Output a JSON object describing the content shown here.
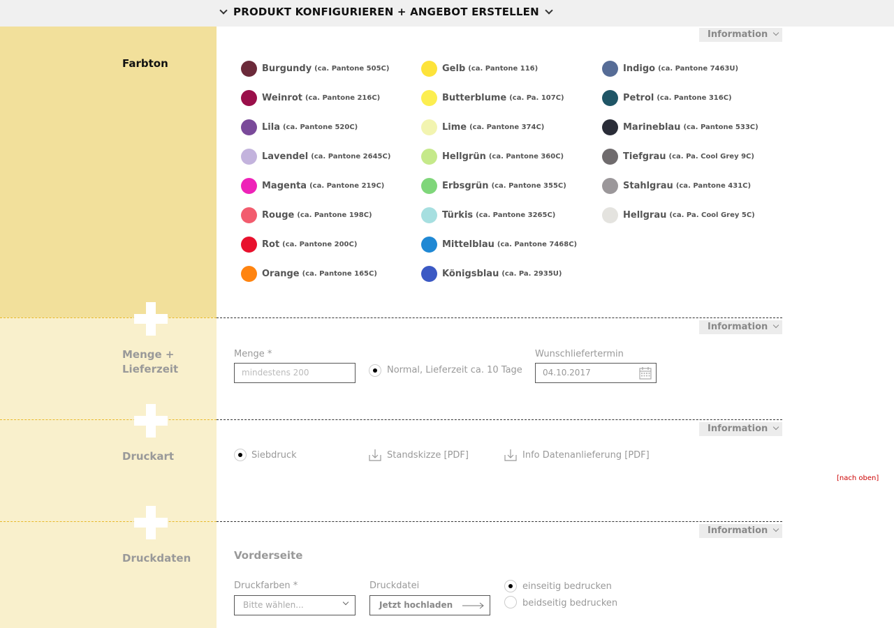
{
  "header": {
    "title": "PRODUKT KONFIGURIEREN + ANGEBOT ERSTELLEN"
  },
  "info_label": "Information",
  "farbton": {
    "label": "Farbton",
    "columns": [
      [
        {
          "name": "Burgundy",
          "pantone": "(ca. Pantone 505C)",
          "color": "#6b2a3a"
        },
        {
          "name": "Weinrot",
          "pantone": "(ca. Pantone 216C)",
          "color": "#9a0f4a"
        },
        {
          "name": "Lila",
          "pantone": "(ca. Pantone 520C)",
          "color": "#7a4a9a"
        },
        {
          "name": "Lavendel",
          "pantone": "(ca. Pantone 2645C)",
          "color": "#c3b3dd"
        },
        {
          "name": "Magenta",
          "pantone": "(ca. Pantone 219C)",
          "color": "#ee22b8"
        },
        {
          "name": "Rouge",
          "pantone": "(ca. Pantone 198C)",
          "color": "#f25c6e"
        },
        {
          "name": "Rot",
          "pantone": "(ca. Pantone 200C)",
          "color": "#e8112d"
        },
        {
          "name": "Orange",
          "pantone": "(ca. Pantone 165C)",
          "color": "#ff8410"
        }
      ],
      [
        {
          "name": "Gelb",
          "pantone": "(ca. Pantone 116)",
          "color": "#fde33a"
        },
        {
          "name": "Butterblume",
          "pantone": "(ca. Pa. 107C)",
          "color": "#fcee50"
        },
        {
          "name": "Lime",
          "pantone": "(ca. Pantone 374C)",
          "color": "#f2f4b0"
        },
        {
          "name": "Hellgrün",
          "pantone": "(ca. Pantone 360C)",
          "color": "#c5e98a"
        },
        {
          "name": "Erbsgrün",
          "pantone": "(ca. Pantone 355C)",
          "color": "#7fd67a"
        },
        {
          "name": "Türkis",
          "pantone": "(ca. Pantone 3265C)",
          "color": "#a6dfe0"
        },
        {
          "name": "Mittelblau",
          "pantone": "(ca. Pantone 7468C)",
          "color": "#1f88d4"
        },
        {
          "name": "Königsblau",
          "pantone": "(ca. Pa. 2935U)",
          "color": "#3b59c4"
        }
      ],
      [
        {
          "name": "Indigo",
          "pantone": "(ca. Pantone 7463U)",
          "color": "#566c96"
        },
        {
          "name": "Petrol",
          "pantone": "(ca. Pantone 316C)",
          "color": "#1f5566"
        },
        {
          "name": "Marineblau",
          "pantone": "(ca. Pantone 533C)",
          "color": "#2a2d38"
        },
        {
          "name": "Tiefgrau",
          "pantone": "(ca. Pa. Cool Grey 9C)",
          "color": "#6f6b6d"
        },
        {
          "name": "Stahlgrau",
          "pantone": "(ca. Pantone 431C)",
          "color": "#9b979a"
        },
        {
          "name": "Hellgrau",
          "pantone": "(ca. Pa. Cool Grey 5C)",
          "color": "#e4e3df"
        }
      ]
    ]
  },
  "menge": {
    "label_line1": "Menge +",
    "label_line2": "Lieferzeit",
    "field_label": "Menge *",
    "field_placeholder": "mindestens 200",
    "radio_label": "Normal, Lieferzeit ca. 10 Tage",
    "date_label": "Wunschliefertermin",
    "date_value": "04.10.2017"
  },
  "druckart": {
    "label": "Druckart",
    "radio_label": "Siebdruck",
    "download1": "Standskizze [PDF]",
    "download2": "Info Datenanlieferung [PDF]",
    "back_to_top": "[nach oben]"
  },
  "druckdaten": {
    "label": "Druckdaten",
    "subheading": "Vorderseite",
    "colors_label": "Druckfarben *",
    "colors_placeholder": "Bitte wählen...",
    "file_label": "Druckdatei",
    "upload_label": "Jetzt hochladen",
    "radio1": "einseitig bedrucken",
    "radio2": "beidseitig bedrucken"
  },
  "accent_colors": {
    "side_active": "#f2e09b",
    "side_inactive": "#f9f0cc",
    "link_red": "#cc0000"
  }
}
